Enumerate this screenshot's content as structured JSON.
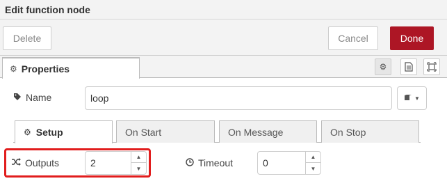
{
  "dialog": {
    "title": "Edit function node",
    "delete_label": "Delete",
    "cancel_label": "Cancel",
    "done_label": "Done"
  },
  "tabs": {
    "properties_label": "Properties"
  },
  "name_field": {
    "label": "Name",
    "value": "loop"
  },
  "subtabs": [
    {
      "label": "Setup",
      "icon": "gear-icon",
      "active": true
    },
    {
      "label": "On Start"
    },
    {
      "label": "On Message"
    },
    {
      "label": "On Stop"
    }
  ],
  "outputs": {
    "label": "Outputs",
    "value": "2"
  },
  "timeout": {
    "label": "Timeout",
    "value": "0"
  },
  "colors": {
    "done_button": "#ad1625",
    "highlight": "#e11d1d"
  }
}
